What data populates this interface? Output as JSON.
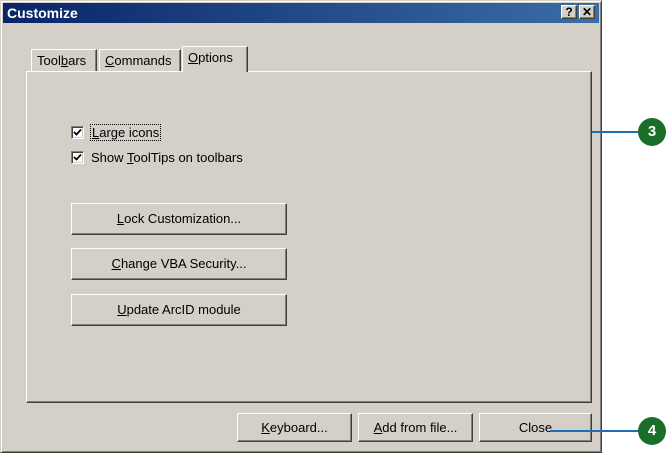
{
  "window": {
    "title": "Customize",
    "help_button": "?",
    "close_button": "✕"
  },
  "tabs": [
    {
      "pre": "Tool",
      "key": "b",
      "post": "ars",
      "active": false
    },
    {
      "pre": "",
      "key": "C",
      "post": "ommands",
      "active": false
    },
    {
      "pre": "",
      "key": "O",
      "post": "ptions",
      "active": true
    }
  ],
  "options": {
    "large_icons": {
      "pre": "",
      "key": "L",
      "post": "arge icons",
      "checked": true
    },
    "show_tooltips": {
      "pre": "Show ",
      "key": "T",
      "post": "oolTips on toolbars",
      "checked": true
    }
  },
  "buttons": {
    "lock": {
      "pre": "",
      "key": "L",
      "post": "ock Customization..."
    },
    "vba": {
      "pre": "",
      "key": "C",
      "post": "hange VBA Security..."
    },
    "arcid": {
      "pre": "",
      "key": "U",
      "post": "pdate ArcID module"
    },
    "keyboard": {
      "pre": "",
      "key": "K",
      "post": "eyboard..."
    },
    "add_from_file": {
      "pre": "",
      "key": "A",
      "post": "dd from file..."
    },
    "close": {
      "label": "Close"
    }
  },
  "callouts": {
    "step3": "3",
    "step4": "4"
  },
  "colors": {
    "titlebar_start": "#0a246a",
    "titlebar_end": "#3a6ea5",
    "callout_line": "#1f6fb5",
    "callout_dot": "#1a6e2a",
    "face": "#d4d0c8"
  }
}
